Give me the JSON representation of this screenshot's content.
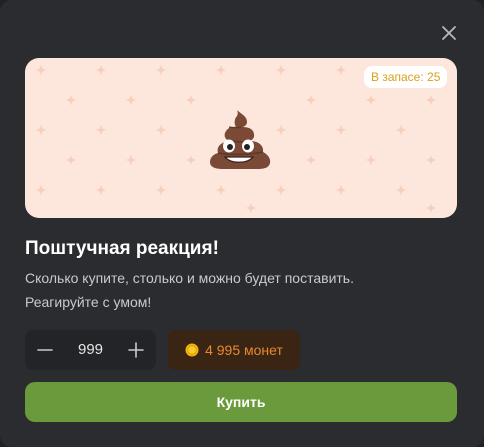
{
  "modal": {
    "close_icon": "close-icon",
    "banner": {
      "stock_badge": "В запасе: 25",
      "emoji_icon": "poop-emoji",
      "background_color": "#fde7dd"
    },
    "title": "Поштучная реакция!",
    "description_line1": "Сколько купите, столько и можно будет поставить.",
    "description_line2": "Реагируйте с умом!",
    "stepper": {
      "decrement_icon": "minus-icon",
      "value": "999",
      "increment_icon": "plus-icon"
    },
    "price": {
      "coin_icon": "coin-icon",
      "label": "4 995 монет",
      "color": "#e9892f"
    },
    "buy_button": {
      "label": "Купить",
      "color": "#6a9a3c"
    }
  }
}
